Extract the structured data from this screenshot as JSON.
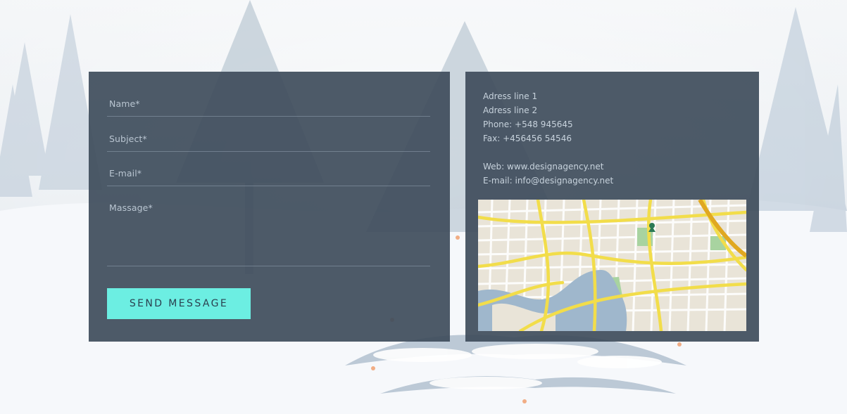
{
  "form": {
    "name_placeholder": "Name*",
    "subject_placeholder": "Subject*",
    "email_placeholder": "E-mail*",
    "message_placeholder": "Massage*",
    "submit_label": "SEND MESSAGE"
  },
  "contact": {
    "address_line_1": "Adress line 1",
    "address_line_2": "Adress line 2",
    "phone": "Phone: +548 945645",
    "fax": "Fax: +456456 54546",
    "web": "Web: www.designagency.net",
    "email": "E-mail: info@designagency.net"
  },
  "map": {
    "icon": "map-pin-icon"
  },
  "colors": {
    "panel": "#3f4e5c",
    "accent_button": "#6ceee2",
    "map_road": "#f2dd4a",
    "map_water": "#9fb7cc",
    "map_park": "#a8d3a0"
  }
}
